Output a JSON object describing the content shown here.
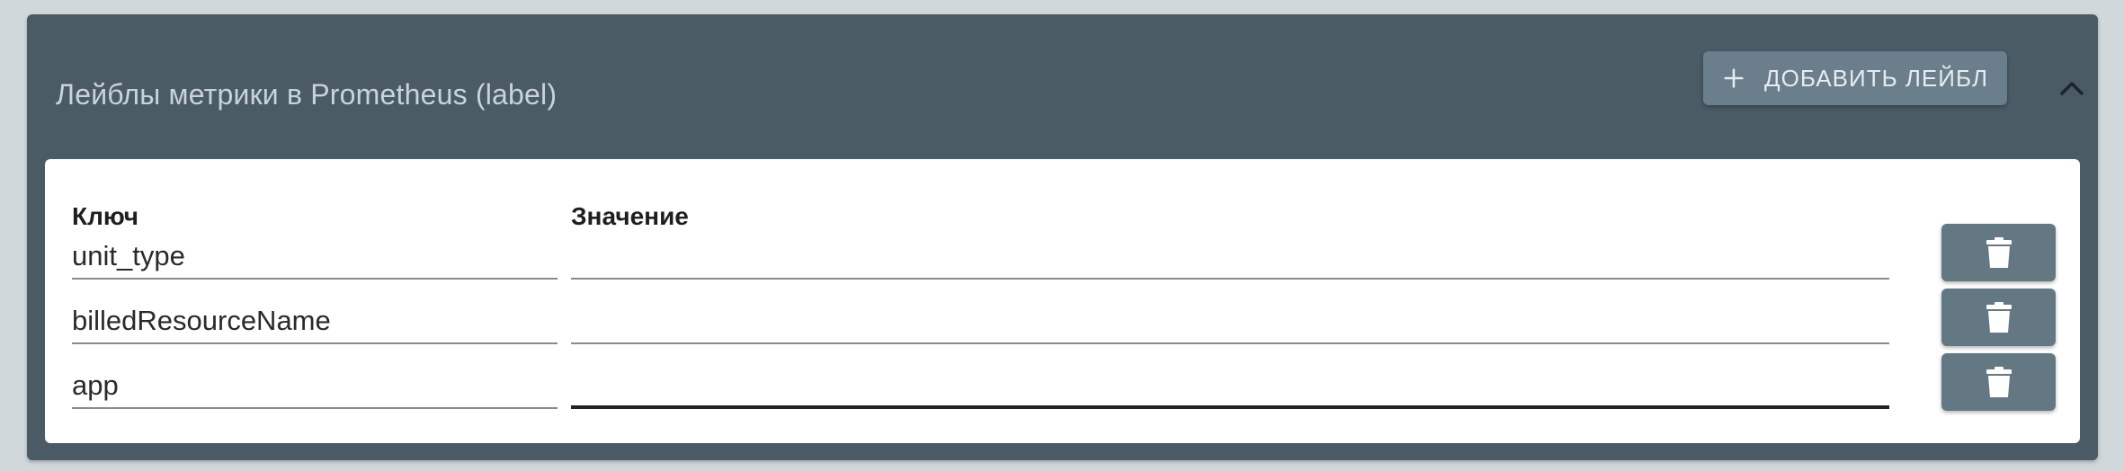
{
  "panel": {
    "title": "Лейблы метрики в Prometheus (label)",
    "add_button_label": "ДОБАВИТЬ ЛЕЙБЛ",
    "add_icon": "plus-icon",
    "collapse_icon": "chevron-up-icon"
  },
  "table": {
    "headers": {
      "key": "Ключ",
      "value": "Значение"
    },
    "rows": [
      {
        "key": "unit_type",
        "value": "",
        "delete_icon": "trash-icon"
      },
      {
        "key": "billedResourceName",
        "value": "",
        "delete_icon": "trash-icon"
      },
      {
        "key": "app",
        "value": "",
        "delete_icon": "trash-icon",
        "focused": true
      }
    ]
  },
  "colors": {
    "background": "#d0d8dc",
    "panel": "#4a5b66",
    "button": "#6a7e8b",
    "delete_button": "#647884"
  }
}
